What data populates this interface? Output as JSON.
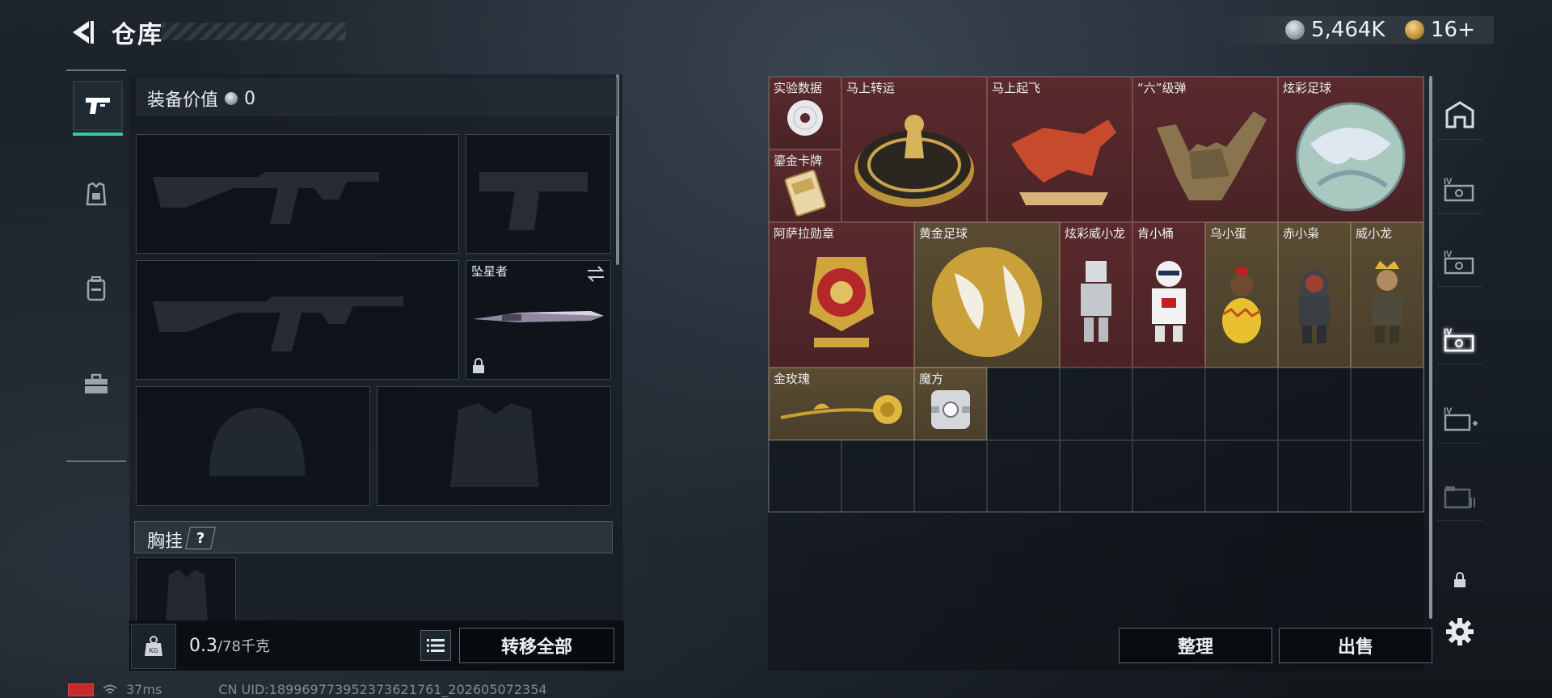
{
  "header": {
    "title": "仓库",
    "currency_primary": "5,464K",
    "currency_secondary": "16+"
  },
  "left_tabs": [
    {
      "name": "weapons",
      "icon": "pistol-icon",
      "active": true
    },
    {
      "name": "armor",
      "icon": "armor-icon",
      "active": false
    },
    {
      "name": "backpack",
      "icon": "backpack-icon",
      "active": false
    },
    {
      "name": "toolbox",
      "icon": "toolbox-icon",
      "active": false
    }
  ],
  "equipment": {
    "value_label": "装备价值",
    "value": "0",
    "melee_name": "坠星者",
    "chest_rig_label": "胸挂",
    "chest_rig_help": "?",
    "weight_current": "0.3",
    "weight_max": "/78千克",
    "transfer_all_label": "转移全部"
  },
  "storage": {
    "items": [
      {
        "name": "实验数据",
        "style": "red",
        "icon": "cd-icon"
      },
      {
        "name": "鎏金卡牌",
        "style": "red",
        "icon": "gold-card-icon"
      },
      {
        "name": "马上转运",
        "style": "red",
        "icon": "fortune-wheel-icon"
      },
      {
        "name": "马上起飞",
        "style": "red",
        "icon": "red-horse-icon"
      },
      {
        "name": "“六”级弹",
        "style": "red",
        "icon": "shaka-hand-icon"
      },
      {
        "name": "炫彩足球",
        "style": "red",
        "icon": "iridescent-ball-icon"
      },
      {
        "name": "阿萨拉勋章",
        "style": "red",
        "icon": "medal-icon"
      },
      {
        "name": "黄金足球",
        "style": "gold",
        "icon": "golden-ball-icon"
      },
      {
        "name": "炫彩威小龙",
        "style": "red",
        "icon": "silver-figure-icon"
      },
      {
        "name": "肯小桶",
        "style": "red",
        "icon": "colonel-figure-icon"
      },
      {
        "name": "乌小蛋",
        "style": "gold",
        "icon": "egg-figure-icon"
      },
      {
        "name": "赤小枭",
        "style": "gold",
        "icon": "hooded-figure-icon"
      },
      {
        "name": "威小龙",
        "style": "gold",
        "icon": "crowned-figure-icon"
      },
      {
        "name": "金玫瑰",
        "style": "gold",
        "icon": "golden-rose-icon"
      },
      {
        "name": "魔方",
        "style": "gold",
        "icon": "cube-icon"
      }
    ],
    "sort_label": "整理",
    "sell_label": "出售"
  },
  "right_tabs": [
    {
      "name": "safe-house",
      "icon": "safehouse-icon"
    },
    {
      "name": "storage-iv-1",
      "icon": "storage-iv-icon"
    },
    {
      "name": "storage-iv-2",
      "icon": "storage-iv-icon"
    },
    {
      "name": "storage-iv-3",
      "icon": "storage-iv-icon",
      "active": true
    },
    {
      "name": "storage-iv-add",
      "icon": "storage-add-icon"
    },
    {
      "name": "storage-locked",
      "icon": "storage-locked-icon"
    },
    {
      "name": "lock",
      "icon": "lock-icon"
    },
    {
      "name": "settings",
      "icon": "gear-icon"
    }
  ],
  "status_bar": {
    "ping": "37ms",
    "uid": "CN UID:189969773952373621761_202605072354"
  },
  "colors": {
    "accent": "#39c9a0",
    "red_rarity": "#5a2a2d",
    "gold_rarity": "#5a4c33"
  }
}
